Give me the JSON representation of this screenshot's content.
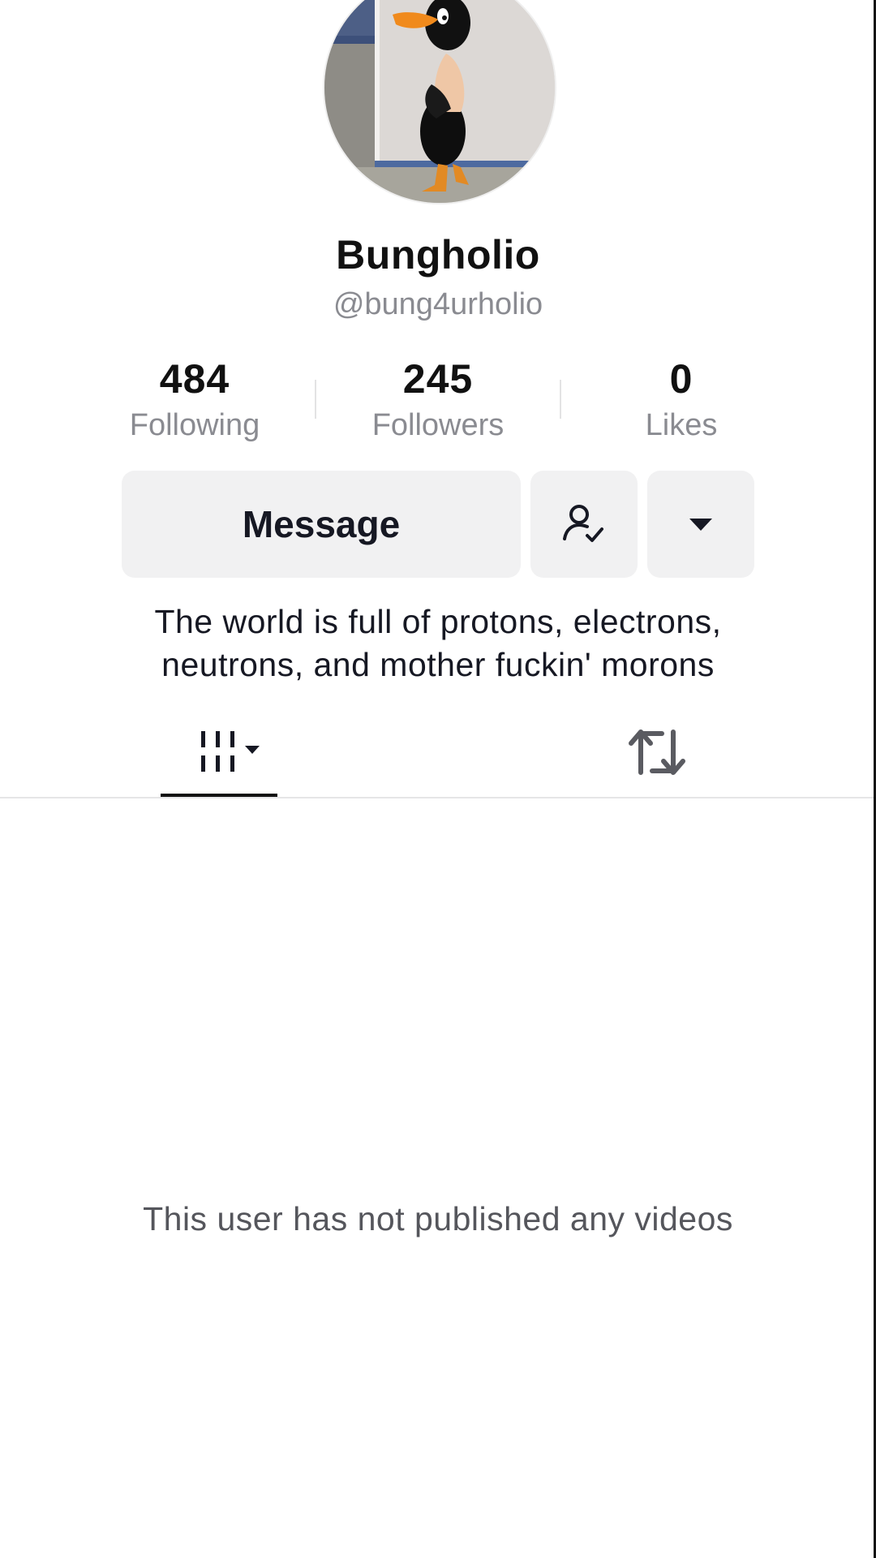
{
  "profile": {
    "display_name": "Bungholio",
    "username": "@bung4urholio",
    "avatar_icon": "cartoon-duck-avatar",
    "bio": "The world is full of protons, electrons, neutrons, and mother fuckin' morons"
  },
  "stats": {
    "following": {
      "value": "484",
      "label": "Following"
    },
    "followers": {
      "value": "245",
      "label": "Followers"
    },
    "likes": {
      "value": "0",
      "label": "Likes"
    }
  },
  "actions": {
    "message_label": "Message",
    "friend_icon": "person-check-icon",
    "more_icon": "caret-down-icon"
  },
  "tabs": [
    {
      "icon": "videos-grid-icon",
      "selected": true
    },
    {
      "icon": "repost-icon",
      "selected": false
    }
  ],
  "empty_state": {
    "text": "This user has not published any videos"
  },
  "colors": {
    "primary_text": "#161823",
    "secondary_text": "#8a8b91",
    "button_bg": "#f1f1f2",
    "tab_indicator": "#111111"
  }
}
